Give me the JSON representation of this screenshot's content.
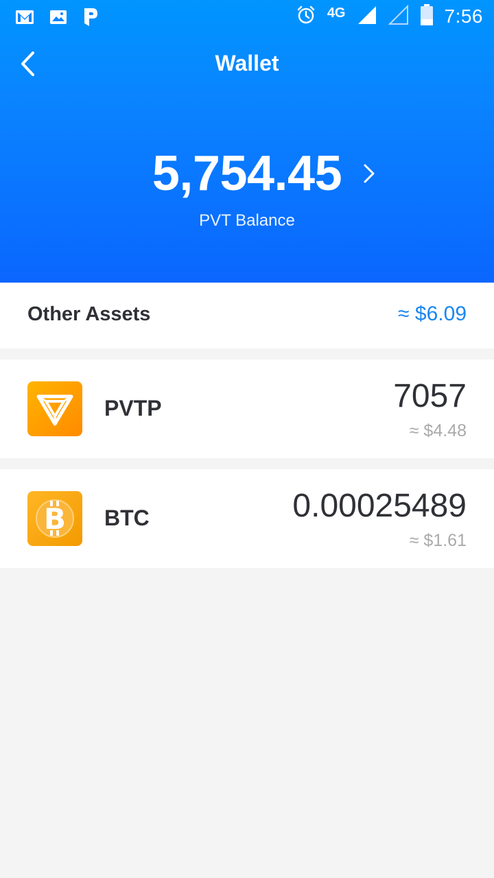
{
  "status_bar": {
    "time": "7:56",
    "network": "4G",
    "icons": [
      "gmail-icon",
      "gallery-icon",
      "app-p-icon",
      "alarm-icon",
      "signal-icon",
      "signal-empty-icon",
      "battery-icon"
    ]
  },
  "header": {
    "title": "Wallet",
    "back_icon": "chevron-left-icon"
  },
  "balance": {
    "amount": "5,754.45",
    "label": "PVT Balance",
    "chevron_icon": "chevron-right-icon"
  },
  "other_assets": {
    "title": "Other Assets",
    "total": "≈ $6.09"
  },
  "assets": [
    {
      "symbol": "PVTP",
      "amount": "7057",
      "fiat": "≈ $4.48",
      "icon": "pvtp-token-icon",
      "color": "#ff9a00"
    },
    {
      "symbol": "BTC",
      "amount": "0.00025489",
      "fiat": "≈ $1.61",
      "icon": "bitcoin-icon",
      "color": "#f6a10c"
    }
  ],
  "colors": {
    "header_top": "#0095ff",
    "header_bottom": "#0a66ff",
    "accent": "#1a87f0",
    "background": "#f4f4f4"
  }
}
